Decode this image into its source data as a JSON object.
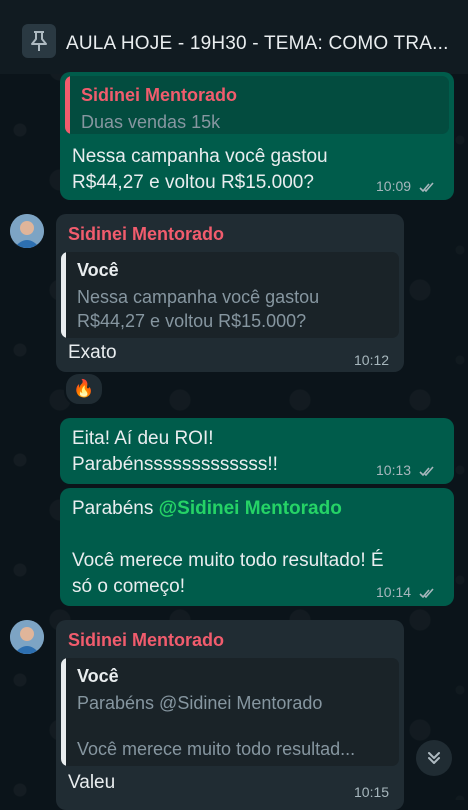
{
  "pinned": {
    "text": "AULA HOJE - 19H30 - TEMA: COMO TRA..."
  },
  "messages": [
    {
      "quote_name": "Sidinei Mentorado",
      "quote_text": "Duas vendas 15k",
      "text_line1": "Nessa campanha você gastou",
      "text_line2": "R$44,27 e voltou R$15.000?",
      "time": "10:09"
    },
    {
      "sender": "Sidinei Mentorado",
      "quote_name": "Você",
      "quote_line1": "Nessa campanha você gastou",
      "quote_line2": "R$44,27 e voltou R$15.000?",
      "text": "Exato",
      "time": "10:12",
      "reaction": "🔥"
    },
    {
      "text_line1": "Eita! Aí deu ROI!",
      "text_line2": "Parabénsssssssssssss!!",
      "time": "10:13"
    },
    {
      "text_prefix": "Parabéns ",
      "mention": "@Sidinei Mentorado",
      "text_line2": "Você merece muito todo resultado! É",
      "text_line3": "só o começo!",
      "time": "10:14"
    },
    {
      "sender": "Sidinei Mentorado",
      "quote_name": "Você",
      "quote_line1": "Parabéns @Sidinei Mentorado",
      "quote_line2": "Você merece muito todo resultad...",
      "text": "Valeu",
      "time": "10:15"
    }
  ],
  "colors": {
    "outgoing_bubble": "#005c4b",
    "incoming_bubble": "#202c33",
    "sender_name": "#f15c6d",
    "mention": "#25d366",
    "background": "#0b141a"
  },
  "icons": {
    "pin": "pin-icon",
    "read_receipt": "double-check-icon",
    "scroll_down": "double-chevron-down-icon",
    "avatar": "avatar"
  }
}
